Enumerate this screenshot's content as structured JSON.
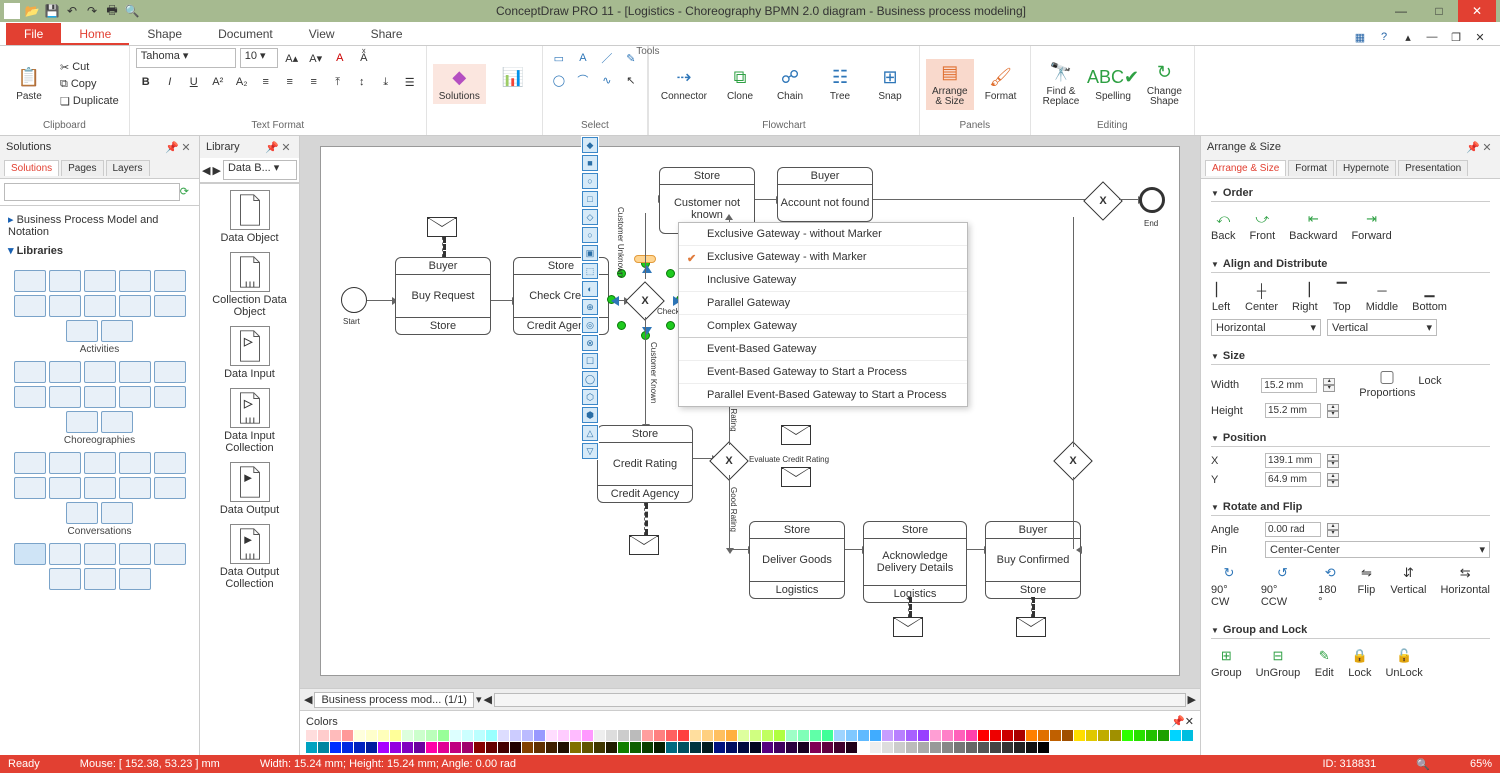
{
  "app_title": "ConceptDraw PRO 11 - [Logistics - Choreography BPMN 2.0 diagram - Business process modeling]",
  "menu": {
    "file": "File",
    "tabs": [
      "Home",
      "Shape",
      "Document",
      "View",
      "Share"
    ],
    "active": "Home"
  },
  "ribbon": {
    "clipboard": {
      "label": "Clipboard",
      "paste": "Paste",
      "cut": "Cut",
      "copy": "Copy",
      "duplicate": "Duplicate"
    },
    "textformat": {
      "label": "Text Format",
      "font": "Tahoma",
      "size": "10"
    },
    "solutions": {
      "label": "",
      "btn": "Solutions"
    },
    "select": {
      "label": "Select"
    },
    "tools": {
      "label": "Tools"
    },
    "flowchart": {
      "label": "Flowchart",
      "connector": "Connector",
      "clone": "Clone",
      "chain": "Chain",
      "tree": "Tree",
      "snap": "Snap"
    },
    "panels": {
      "label": "Panels",
      "arrange": "Arrange\n& Size",
      "format": "Format"
    },
    "editing": {
      "label": "Editing",
      "find": "Find &\nReplace",
      "spelling": "Spelling",
      "change": "Change\nShape"
    }
  },
  "solutions_panel": {
    "title": "Solutions",
    "tabs": [
      "Solutions",
      "Pages",
      "Layers"
    ],
    "tree": [
      "Business Process Model and Notation"
    ],
    "libs_label": "Libraries",
    "cats": [
      "Activities",
      "Choreographies",
      "Conversations"
    ]
  },
  "library_panel": {
    "title": "Library",
    "dropdown": "Data B...",
    "items": [
      "Data Object",
      "Collection Data Object",
      "Data Input",
      "Data Input Collection",
      "Data Output",
      "Data Output Collection"
    ]
  },
  "context_menu": {
    "items": [
      {
        "label": "Exclusive Gateway - without Marker"
      },
      {
        "label": "Exclusive Gateway - with Marker",
        "checked": true
      },
      {
        "label": "Inclusive Gateway",
        "group": true
      },
      {
        "label": "Parallel Gateway"
      },
      {
        "label": "Complex Gateway"
      },
      {
        "label": "Event-Based Gateway",
        "group": true
      },
      {
        "label": "Event-Based Gateway to Start a Process"
      },
      {
        "label": "Parallel  Event-Based Gateway to Start a Process"
      }
    ]
  },
  "canvas": {
    "start_label": "Start",
    "end_label": "End",
    "nodes": {
      "buy_request": {
        "top": "Buyer",
        "mid": "Buy Request",
        "bot": "Store"
      },
      "check_credit": {
        "top": "Store",
        "mid": "Check Credit",
        "bot": "Credit Agency"
      },
      "store_top": {
        "top": "Store",
        "mid": "Customer not known"
      },
      "buyer_top": {
        "top": "Buyer",
        "mid": "Account not found"
      },
      "credit_rating": {
        "top": "Store",
        "mid": "Credit Rating",
        "bot": "Credit Agency"
      },
      "deliver": {
        "top": "Store",
        "mid": "Deliver Goods",
        "bot": "Logistics"
      },
      "ack": {
        "top": "Store",
        "mid": "Acknowledge Delivery Details",
        "bot": "Logistics"
      },
      "confirm": {
        "top": "Buyer",
        "mid": "Buy Confirmed",
        "bot": "Store"
      }
    },
    "labels": {
      "cust_unknown": "Customer Unknown",
      "cust_known": "Customer Known",
      "eval": "Evaluate Credit Rating",
      "bad": "Bad Rating",
      "good": "Good Rating",
      "check": "Check"
    }
  },
  "page_tabs": {
    "name": "Business process mod... (1/1)"
  },
  "colors_title": "Colors",
  "right": {
    "title": "Arrange & Size",
    "tabs": [
      "Arrange & Size",
      "Format",
      "Hypernote",
      "Presentation"
    ],
    "order": {
      "title": "Order",
      "back": "Back",
      "front": "Front",
      "backward": "Backward",
      "forward": "Forward"
    },
    "align": {
      "title": "Align and Distribute",
      "left": "Left",
      "center": "Center",
      "right": "Right",
      "top": "Top",
      "middle": "Middle",
      "bottom": "Bottom",
      "h": "Horizontal",
      "v": "Vertical"
    },
    "size": {
      "title": "Size",
      "w_label": "Width",
      "h_label": "Height",
      "w": "15.2 mm",
      "h": "15.2 mm",
      "lock": "Lock Proportions"
    },
    "position": {
      "title": "Position",
      "x_label": "X",
      "y_label": "Y",
      "x": "139.1 mm",
      "y": "64.9 mm"
    },
    "rotate": {
      "title": "Rotate and Flip",
      "a_label": "Angle",
      "a": "0.00 rad",
      "pin_label": "Pin",
      "pin": "Center-Center",
      "cw": "90° CW",
      "ccw": "90° CCW",
      "r180": "180 °",
      "flip": "Flip",
      "vf": "Vertical",
      "hf": "Horizontal"
    },
    "group": {
      "title": "Group and Lock",
      "group": "Group",
      "ungroup": "UnGroup",
      "edit": "Edit",
      "lock": "Lock",
      "unlock": "UnLock"
    }
  },
  "status": {
    "ready": "Ready",
    "mouse": "Mouse: [ 152.38, 53.23 ] mm",
    "dims": "Width: 15.24 mm;    Height: 15.24 mm;  Angle: 0.00 rad",
    "id": "ID: 318831",
    "zoom": "65%"
  },
  "swatches": [
    "#fdd",
    "#fcc",
    "#fbb",
    "#f99",
    "#ffd",
    "#ffc",
    "#ffb",
    "#ff9",
    "#dfd",
    "#cfc",
    "#bfb",
    "#9f9",
    "#dff",
    "#cff",
    "#bff",
    "#9ff",
    "#ddf",
    "#ccf",
    "#bbf",
    "#99f",
    "#fdf",
    "#fcf",
    "#fbf",
    "#f9f",
    "#eee",
    "#ddd",
    "#ccc",
    "#bbb",
    "#ff9e9e",
    "#ff8080",
    "#ff6060",
    "#ff4040",
    "#ffde9e",
    "#ffd080",
    "#ffc060",
    "#ffb040",
    "#deff9e",
    "#d0ff80",
    "#c0ff60",
    "#b0ff40",
    "#9effc7",
    "#80ffb8",
    "#60ffa8",
    "#40ff98",
    "#9ed4ff",
    "#80c8ff",
    "#60baff",
    "#40acff",
    "#c79eff",
    "#b880ff",
    "#a860ff",
    "#9840ff",
    "#ff9ed4",
    "#ff80c8",
    "#ff60ba",
    "#ff40ac",
    "#f00",
    "#e00",
    "#c00",
    "#a00",
    "#ff8000",
    "#e07000",
    "#c06000",
    "#a05000",
    "#ffde00",
    "#e0c800",
    "#c0ac00",
    "#a09000",
    "#2eff00",
    "#28e000",
    "#22c000",
    "#1ca000",
    "#00d4ff",
    "#00bee0",
    "#00a2c0",
    "#0086a0",
    "#002eff",
    "#0028e0",
    "#0022c0",
    "#001ca0",
    "#a800ff",
    "#9400e0",
    "#8000c0",
    "#6c00a0",
    "#ff00a8",
    "#e00094",
    "#c00080",
    "#a0006c",
    "#800",
    "#600",
    "#400",
    "#200",
    "#804000",
    "#603000",
    "#402000",
    "#201000",
    "#807000",
    "#605400",
    "#403800",
    "#201c00",
    "#128000",
    "#0e6000",
    "#0a4000",
    "#062000",
    "#006a80",
    "#005060",
    "#003640",
    "#001c20",
    "#001280",
    "#000e60",
    "#000a40",
    "#000620",
    "#540080",
    "#400060",
    "#2c0040",
    "#180020",
    "#800054",
    "#600040",
    "#40002c",
    "#200018",
    "#fff",
    "#eee",
    "#ddd",
    "#ccc",
    "#bbb",
    "#aaa",
    "#999",
    "#888",
    "#777",
    "#666",
    "#555",
    "#444",
    "#333",
    "#222",
    "#111",
    "#000"
  ]
}
